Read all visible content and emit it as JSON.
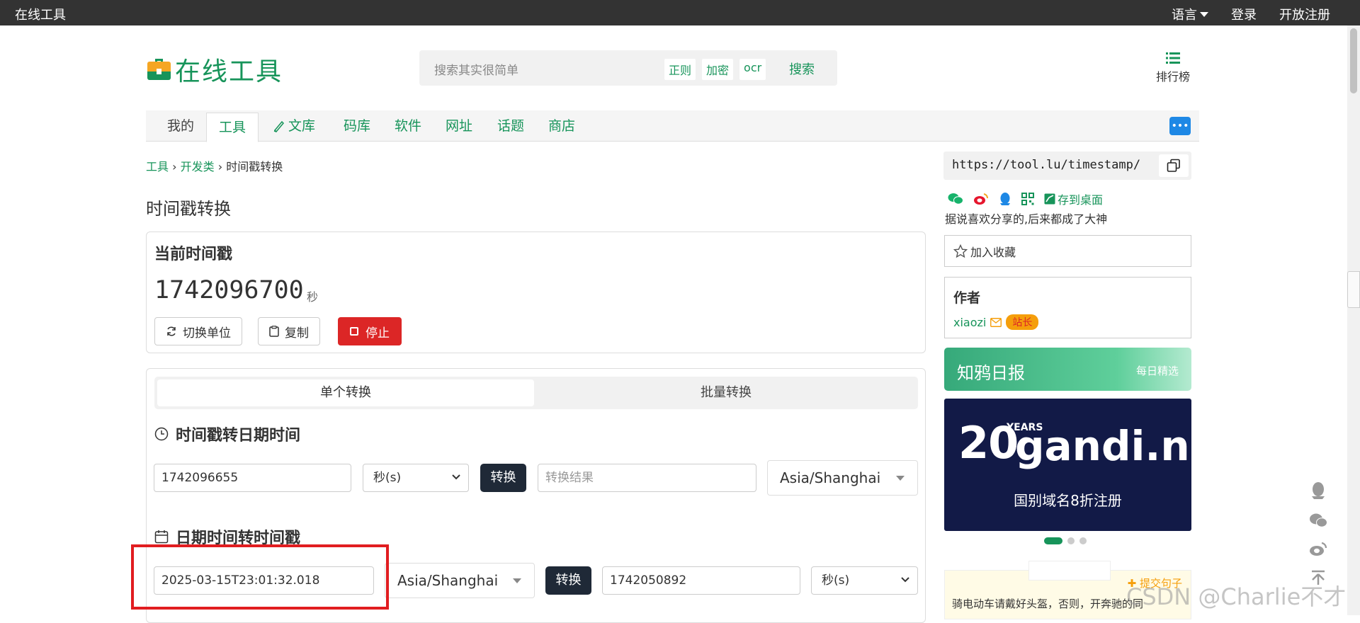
{
  "topbar": {
    "brand": "在线工具",
    "language": "语言",
    "login": "登录",
    "register": "开放注册"
  },
  "header": {
    "logo_text": "在线工具",
    "search_placeholder": "搜索其实很简单",
    "search_tags": [
      "正则",
      "加密",
      "ocr"
    ],
    "search_button": "搜索",
    "rank_label": "排行榜"
  },
  "nav": {
    "items": [
      "我的",
      "工具",
      "文库",
      "码库",
      "软件",
      "网址",
      "话题",
      "商店"
    ],
    "active": "工具"
  },
  "breadcrumb": {
    "l1": "工具",
    "sep": "›",
    "l2": "开发类",
    "current": "时间戳转换"
  },
  "page_title": "时间戳转换",
  "current": {
    "heading": "当前时间戳",
    "timestamp": "1742096700",
    "unit": "秒",
    "btn_switch": "切换单位",
    "btn_copy": "复制",
    "btn_stop": "停止"
  },
  "tabs": {
    "single": "单个转换",
    "batch": "批量转换"
  },
  "ts_to_date": {
    "title": "时间戳转日期时间",
    "input": "1742096655",
    "unit": "秒(s)",
    "convert": "转换",
    "result_placeholder": "转换结果",
    "timezone": "Asia/Shanghai"
  },
  "date_to_ts": {
    "title": "日期时间转时间戳",
    "input": "2025-03-15T23:01:32.018",
    "timezone": "Asia/Shanghai",
    "convert": "转换",
    "result": "1742050892",
    "unit": "秒(s)"
  },
  "sidebar": {
    "url": "https://tool.lu/timestamp/",
    "save_desktop": "存到桌面",
    "share_note": "据说喜欢分享的,后来都成了大神",
    "favorite": "加入收藏",
    "author_heading": "作者",
    "author_name": "xiaozi",
    "author_badge": "站长",
    "zhiya_title": "知鸦日报",
    "zhiya_sub": "每日精选",
    "ad_years": "YEARS",
    "ad_domain": "gandi.net",
    "ad_sub": "国别域名8折注册",
    "quote_submit": "提交句子",
    "quote_text": "骑电动车请戴好头盔，否则，开奔驰的同"
  },
  "watermark": "CSDN @Charlie不才",
  "colors": {
    "brand": "#17945a",
    "danger": "#dc2626",
    "dark": "#1f2937"
  }
}
